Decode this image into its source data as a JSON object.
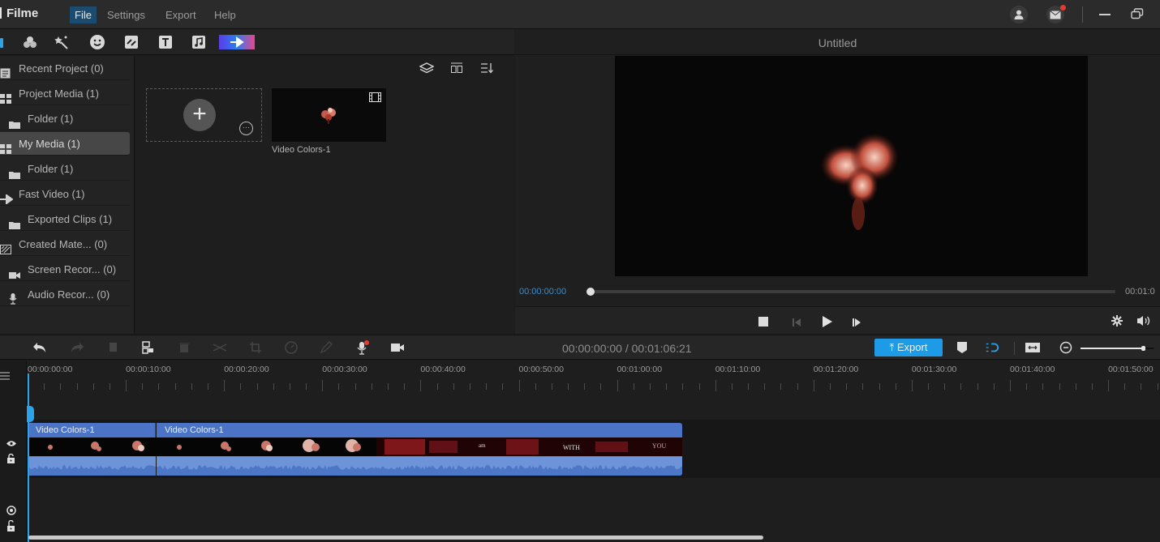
{
  "app": {
    "name": "Filme",
    "menu": [
      "File",
      "Settings",
      "Export",
      "Help"
    ],
    "active_menu": "File",
    "window_controls": [
      "account-icon",
      "mail-icon",
      "minimize-icon",
      "restore-icon"
    ]
  },
  "tools": [
    "media-icon",
    "effects-icon",
    "magic-wand-icon",
    "sticker-icon",
    "transition-icon",
    "text-icon",
    "music-icon",
    "templates-icon"
  ],
  "sidebar": {
    "items": [
      {
        "label": "Recent Project (0)",
        "icon": "document-icon",
        "indent": false,
        "active": false
      },
      {
        "label": "Project Media (1)",
        "icon": "grid-icon",
        "indent": false,
        "active": false
      },
      {
        "label": "Folder (1)",
        "icon": "folder-icon",
        "indent": true,
        "active": false
      },
      {
        "label": "My Media (1)",
        "icon": "grid-icon",
        "indent": false,
        "active": true
      },
      {
        "label": "Folder (1)",
        "icon": "folder-icon",
        "indent": true,
        "active": false
      },
      {
        "label": "Fast Video (1)",
        "icon": "fast-forward-icon",
        "indent": false,
        "active": false
      },
      {
        "label": "Exported Clips (1)",
        "icon": "folder-icon",
        "indent": true,
        "active": false
      },
      {
        "label": "Created Mate... (0)",
        "icon": "pattern-icon",
        "indent": false,
        "active": false
      },
      {
        "label": "Screen Recor... (0)",
        "icon": "camera-icon",
        "indent": true,
        "active": false
      },
      {
        "label": "Audio Recor... (0)",
        "icon": "microphone-icon",
        "indent": true,
        "active": false
      }
    ]
  },
  "media": {
    "items": [
      {
        "label": "Video Colors-1",
        "type": "video"
      }
    ]
  },
  "preview": {
    "title": "Untitled",
    "current_time": "00:00:00:00",
    "end_time": "00:01:0",
    "progress": 0
  },
  "timeline_toolbar": {
    "time_display": "00:00:00:00 / 00:01:06:21",
    "export_label": "Export",
    "zoom_level": 0.85
  },
  "timeline": {
    "ruler": [
      "00:00:00:00",
      "00:00:10:00",
      "00:00:20:00",
      "00:00:30:00",
      "00:00:40:00",
      "00:00:50:00",
      "00:01:00:00",
      "00:01:10:00",
      "00:01:20:00",
      "00:01:30:00",
      "00:01:40:00",
      "00:01:50:00"
    ],
    "clips": [
      {
        "label": "Video Colors-1"
      },
      {
        "label": "Video Colors-1"
      }
    ],
    "thumb_text": [
      "WITH",
      "YOU"
    ]
  }
}
